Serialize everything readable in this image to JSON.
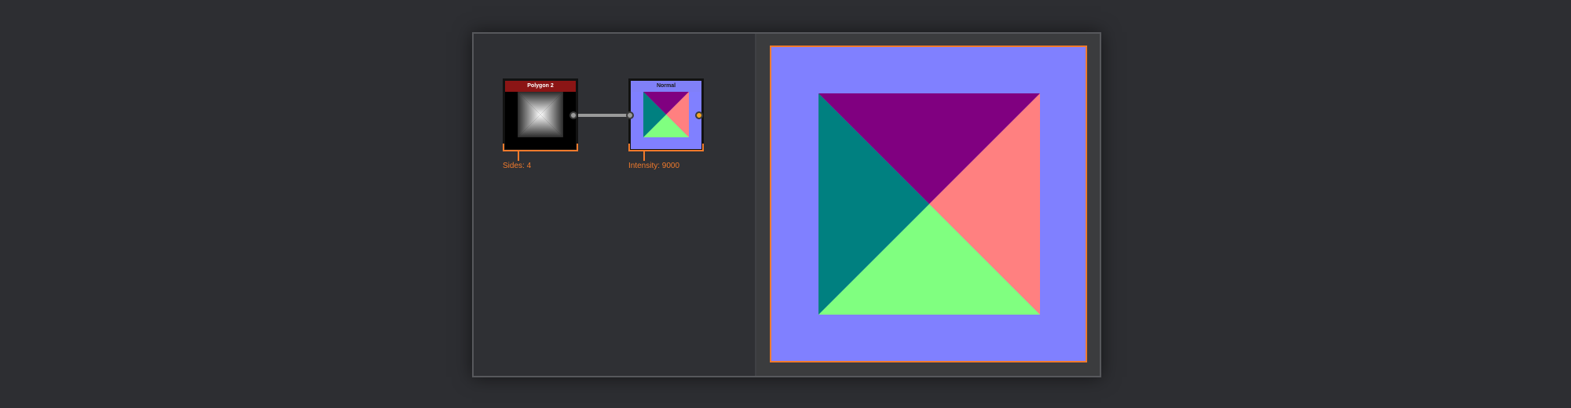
{
  "graph": {
    "nodes": [
      {
        "id": "polygon",
        "title": "Polygon 2",
        "header_color": "#8b1515",
        "param_label": "Sides: 4"
      },
      {
        "id": "normal",
        "title": "Normal",
        "header_color": "#8080f8",
        "param_label": "Intensity: 9000"
      }
    ],
    "connection": {
      "from": "polygon",
      "to": "normal",
      "wire_color": "#9a9a9a"
    },
    "output_port_color": "#f5a623"
  },
  "preview": {
    "selected_node": "normal",
    "highlight_color": "#f07a2c",
    "colors": {
      "background": "#8080ff",
      "top": "#800080",
      "right": "#ff8080",
      "bottom": "#80ff80",
      "left": "#008080"
    }
  }
}
